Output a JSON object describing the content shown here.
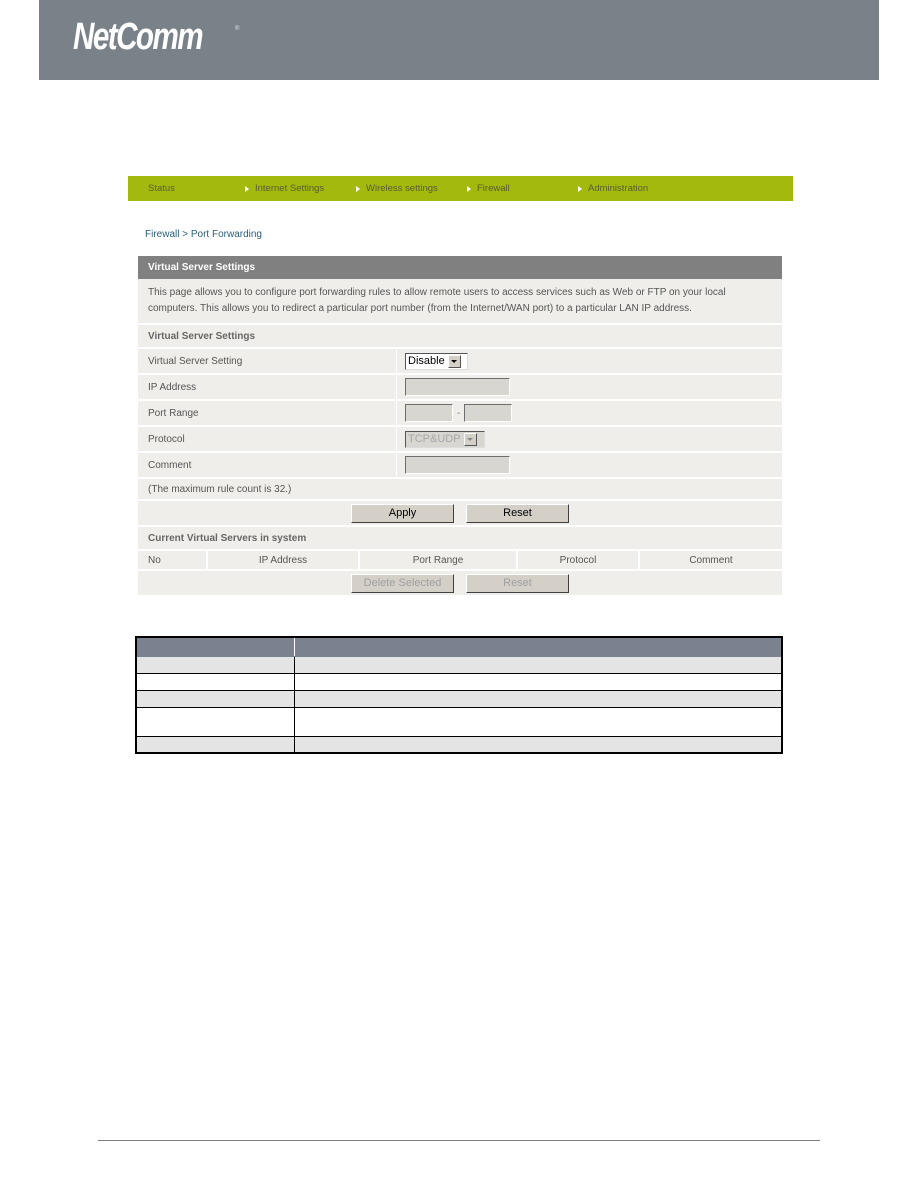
{
  "brand": {
    "logo_text": "NetComm",
    "registered_mark": "®",
    "header_color": "#798189"
  },
  "navbar": {
    "accent_color": "#a3b90e",
    "items": [
      {
        "label": "Status",
        "arrow": false
      },
      {
        "label": "Internet Settings",
        "arrow": true
      },
      {
        "label": "Wireless settings",
        "arrow": true
      },
      {
        "label": "Firewall",
        "arrow": true
      },
      {
        "label": "Administration",
        "arrow": true
      }
    ]
  },
  "breadcrumb": {
    "parent": "Firewall",
    "separator": ">",
    "current": "Port Forwarding"
  },
  "panel": {
    "title": "Virtual Server Settings",
    "description": "This page allows you to configure port forwarding rules to allow remote users to access services such as Web or FTP on your local computers. This allows you to redirect a particular port number (from the Internet/WAN port) to a particular LAN IP address.",
    "section_title": "Virtual Server Settings",
    "fields": {
      "virtual_server_setting": {
        "label": "Virtual Server Setting",
        "value": "Disable"
      },
      "ip_address": {
        "label": "IP Address",
        "value": ""
      },
      "port_range": {
        "label": "Port Range",
        "from": "",
        "separator": "-",
        "to": ""
      },
      "protocol": {
        "label": "Protocol",
        "value": "TCP&UDP"
      },
      "comment": {
        "label": "Comment",
        "value": ""
      }
    },
    "max_rule_note": "(The maximum rule count is 32.)",
    "apply_label": "Apply",
    "reset_label": "Reset",
    "current_title": "Current Virtual Servers in system",
    "columns": [
      "No",
      "IP Address",
      "Port Range",
      "Protocol",
      "Comment"
    ],
    "delete_selected_label": "Delete Selected",
    "reset2_label": "Reset"
  },
  "description_table": {
    "header": [
      "",
      ""
    ],
    "rows": [
      [
        "",
        ""
      ],
      [
        "",
        ""
      ],
      [
        "",
        ""
      ],
      [
        "",
        ""
      ],
      [
        "",
        ""
      ]
    ]
  }
}
